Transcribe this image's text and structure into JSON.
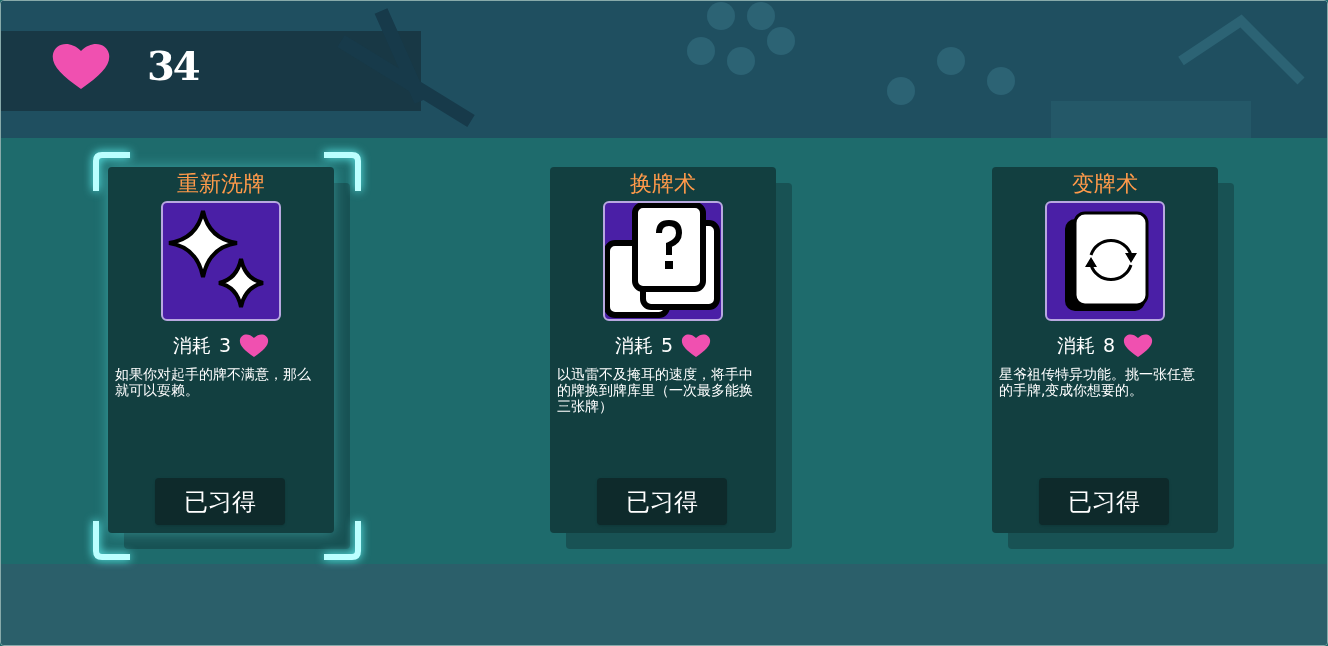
{
  "hearts": {
    "count": "34"
  },
  "cards": [
    {
      "kind": "sparkle",
      "title": "重新洗牌",
      "cost_label": "消耗",
      "cost": "3",
      "description": "如果你对起手的牌不满意，那么就可以耍赖。",
      "button": "已习得",
      "selected": true
    },
    {
      "kind": "swap",
      "title": "换牌术",
      "cost_label": "消耗",
      "cost": "5",
      "description": "以迅雷不及掩耳的速度，将手中的牌换到牌库里（一次最多能换三张牌）",
      "button": "已习得",
      "selected": false
    },
    {
      "kind": "transform",
      "title": "变牌术",
      "cost_label": "消耗",
      "cost": "8",
      "description": "星爷祖传特异功能。挑一张任意的手牌,变成你想要的。",
      "button": "已习得",
      "selected": false
    }
  ]
}
